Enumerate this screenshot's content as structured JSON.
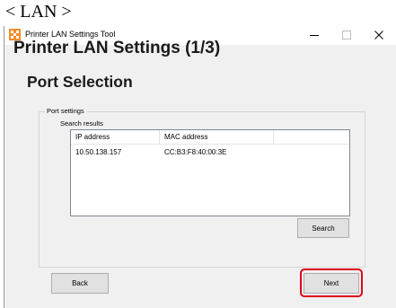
{
  "caption": "< LAN >",
  "window": {
    "title": "Printer LAN Settings Tool",
    "controls": {
      "minimize": "minimize-icon",
      "maximize": "maximize-icon",
      "close": "close-icon"
    }
  },
  "page": {
    "heading": "Printer LAN Settings (1/3)",
    "subheading": "Port Selection"
  },
  "port_settings": {
    "group_label": "Port settings",
    "search_results_label": "Search results",
    "columns": [
      "IP address",
      "MAC address"
    ],
    "rows": [
      {
        "ip": "10.50.138.157",
        "mac": "CC:B3:F8:40:00:3E"
      }
    ],
    "search_button": "Search"
  },
  "footer": {
    "back_button": "Back",
    "next_button": "Next"
  },
  "colors": {
    "highlight": "#e0001a",
    "window_bg": "#f0f0f0",
    "icon_orange": "#f28c28"
  }
}
